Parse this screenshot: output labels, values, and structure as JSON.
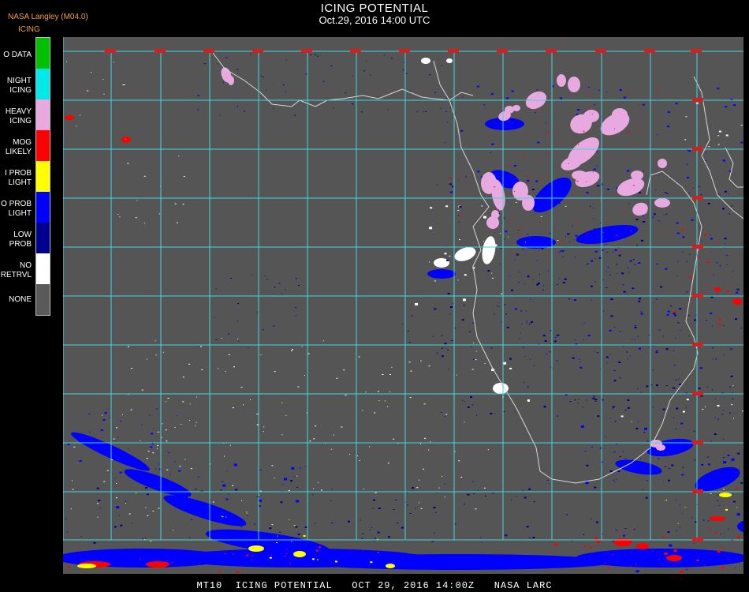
{
  "header": {
    "source": "NASA Langley (M04.0)",
    "product": "ICING",
    "title": "ICING POTENTIAL",
    "subtitle": "Oct.29, 2016 14:00 UTC"
  },
  "legend": [
    {
      "label": "O DATA",
      "color": "#00c000"
    },
    {
      "label": "NIGHT\nICING",
      "color": "#00e8e8"
    },
    {
      "label": "HEAVY\nICING",
      "color": "#e8a8e0"
    },
    {
      "label": "MOG\nLIKELY",
      "color": "#ff0000"
    },
    {
      "label": "I PROB\nLIGHT",
      "color": "#ffff00"
    },
    {
      "label": "O PROB\nLIGHT",
      "color": "#0000ff"
    },
    {
      "label": "LOW\nPROB",
      "color": "#000090"
    },
    {
      "label": "NO\nRETRVL",
      "color": "#ffffff"
    },
    {
      "label": "NONE",
      "color": "#5a5a5a"
    }
  ],
  "colors": {
    "background": "#555555",
    "grid": "#40d8e0",
    "coast": "#d8d8d8",
    "label": "#d02020"
  },
  "footer": "MT10  ICING POTENTIAL   OCT 29, 2016 14:00Z   NASA LARC"
}
